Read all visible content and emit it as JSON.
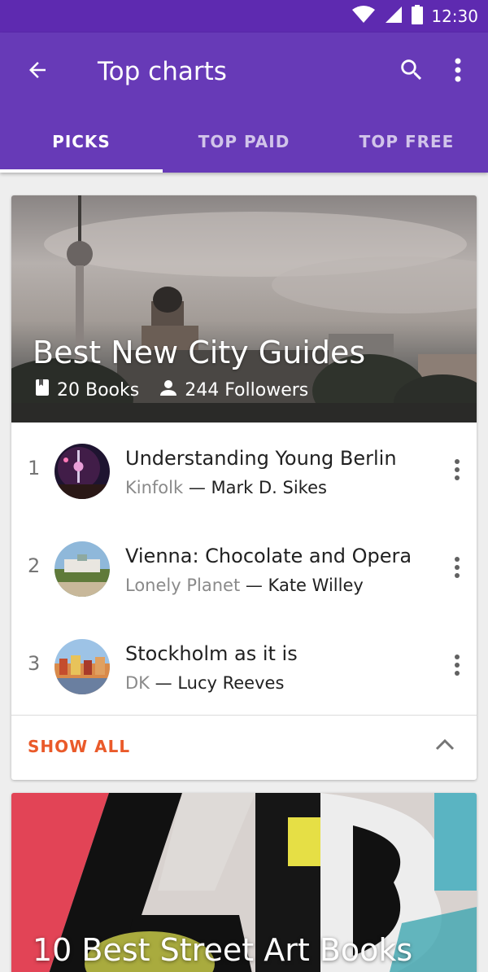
{
  "status_bar": {
    "time": "12:30",
    "icons": [
      "wifi-icon",
      "cell-signal-icon",
      "battery-icon"
    ]
  },
  "toolbar": {
    "title": "Top charts",
    "back_icon": "arrow-back-icon",
    "search_icon": "search-icon",
    "menu_icon": "more-vert-icon"
  },
  "tabs": [
    {
      "label": "PICKS",
      "active": true
    },
    {
      "label": "TOP PAID",
      "active": false
    },
    {
      "label": "TOP FREE",
      "active": false
    }
  ],
  "collection": {
    "title": "Best New City Guides",
    "books_count": "20 Books",
    "followers_count": "244 Followers",
    "items": [
      {
        "rank": "1",
        "title": "Understanding Young Berlin",
        "publisher": "Kinfolk",
        "author": "— Mark D. Sikes"
      },
      {
        "rank": "2",
        "title": "Vienna: Chocolate and Opera",
        "publisher": "Lonely Planet",
        "author": "— Kate Willey"
      },
      {
        "rank": "3",
        "title": "Stockholm as it is",
        "publisher": "DK",
        "author": "— Lucy Reeves"
      }
    ],
    "show_all_label": "SHOW ALL"
  },
  "collection_2": {
    "title": "10 Best Street Art Books"
  },
  "colors": {
    "primary": "#673ab7",
    "status_bar": "#5e2ab0",
    "accent": "#ea5a2a"
  }
}
